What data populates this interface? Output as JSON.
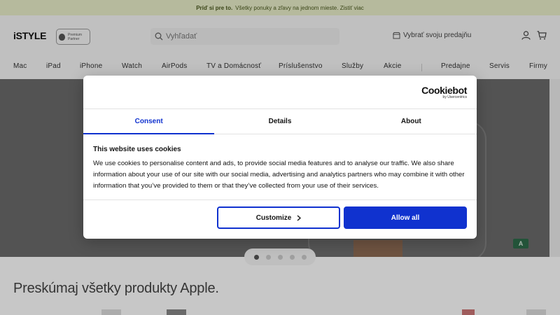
{
  "promo": {
    "bold": "Príď si pre to.",
    "text": "Všetky ponuky a zľavy na jednom mieste. Zistiť viac"
  },
  "header": {
    "logo": "iSTYLE",
    "partner_line1": "Premium",
    "partner_line2": "Partner",
    "search_placeholder": "Vyhľadať",
    "store_label": "Vybrať svoju predajňu"
  },
  "nav": {
    "items": [
      "Mac",
      "iPad",
      "iPhone",
      "Watch",
      "AirPods",
      "TV a Domácnosť",
      "Príslušenstvo",
      "Služby",
      "Akcie"
    ],
    "right_items": [
      "Predajne",
      "Servis",
      "Firmy"
    ]
  },
  "hero": {
    "badge": "A"
  },
  "carousel": {
    "dot_count": 5,
    "active_index": 0
  },
  "section": {
    "title": "Preskúmaj všetky produkty Apple."
  },
  "cookie_dialog": {
    "brand": "Cookiebot",
    "brand_sub": "by Usercentrics",
    "tabs": [
      {
        "label": "Consent",
        "active": true
      },
      {
        "label": "Details",
        "active": false
      },
      {
        "label": "About",
        "active": false
      }
    ],
    "heading": "This website uses cookies",
    "body": "We use cookies to personalise content and ads, to provide social media features and to analyse our traffic. We also share information about your use of our site with our social media, advertising and analytics partners who may combine it with other information that you’ve provided to them or that they’ve collected from your use of their services.",
    "customize_label": "Customize",
    "allow_label": "Allow all",
    "accent_color": "#1032cf"
  }
}
